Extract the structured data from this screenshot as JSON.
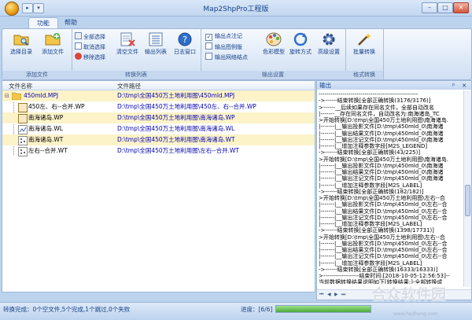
{
  "window": {
    "title": "Map2ShpPro工程版",
    "min": "–",
    "max": "□",
    "close": "✕",
    "qa_items": [
      "▸",
      "▾"
    ]
  },
  "tabs": [
    {
      "label": "功能"
    },
    {
      "label": "帮助"
    }
  ],
  "ribbon": {
    "add_group": {
      "label": "添加文件",
      "select_dir": "选择目录",
      "add_file": "添加文件"
    },
    "convert_group": {
      "label": "转换列表",
      "select_all": "全部选择",
      "deselect": "取消选择",
      "remove": "移除选择",
      "clear": "清空文件",
      "export_list": "输出列表",
      "log_window": "日志窗口"
    },
    "output_group": {
      "label": "输出设置",
      "opt1": "输出点注记",
      "opt2": "输出图例版",
      "opt3": "输出网络结点",
      "color_model": "色彩模型",
      "rotate": "旋转方式",
      "advanced": "高级设置"
    },
    "format_group": {
      "label": "格式转换",
      "batch": "批量转换"
    }
  },
  "file_panel": {
    "col_name": "文件名称",
    "col_path": "文件路径",
    "rows": [
      {
        "name": "450mld.MPJ",
        "path": "D:\\tmp\\全国450万土地利用图\\450mld.MPJ"
      },
      {
        "name": "450左、右--合并.WP",
        "path": "D:\\tmp\\全国450万土地利用图\\450左、右--合并.WP"
      },
      {
        "name": "南海诸岛.WP",
        "path": "D:\\tmp\\全国450万土地利用图\\南海诸岛.WP"
      },
      {
        "name": "南海诸岛.WL",
        "path": "D:\\tmp\\全国450万土地利用图\\南海诸岛.WL"
      },
      {
        "name": "南海诸岛.WT",
        "path": "D:\\tmp\\全国450万土地利用图\\南海诸岛.WT"
      },
      {
        "name": "左右--合并.WT",
        "path": "D:\\tmp\\全国450万土地利用图\\左右--合并.WT"
      }
    ]
  },
  "output_panel": {
    "title": "输出",
    "pin": "ᵖ",
    "close": "×",
    "lines": [
      "--------------------------------------------------",
      "->------结束转换[全部正确转换(3176/3176)]",
      ">------__后续如果存在同名文件，全部自动改名",
      "|-------__存在同名文件，自动改名为:南海诸岛_TC",
      ">开始转换[D:\\tmp\\全国450万土地利用图\\南海诸岛.",
      "|-------|__输出投影文件[D:\\tmp\\450mld_0\\南海诸",
      "|-------|__输出结果文件[D:\\tmp\\450mld_0\\南海诸",
      "|-------|__输出注记文件[D:\\tmp\\450mld_0\\南海诸",
      "|-------|__增加注释参数字段[M2S_LEGEND]",
      "->------结束转换[全部正确转换(43/225)]",
      ">开始转换[D:\\tmp\\全国450万土地利用图\\南海诸岛.",
      "|-------|__输出投影文件[D:\\tmp\\450mld_0\\南海诸",
      "|-------|__输出结果文件[D:\\tmp\\450mld_0\\南海诸",
      "|-------|__输出注记文件[D:\\tmp\\450mld_0\\南海诸",
      "|-------|__增加注释参数字段[M2S_LABEL]",
      "->------结束转换[全部正确转换(182/182)]",
      ">开始转换[D:\\tmp\\全国450万土地利用图\\左右--合",
      "|-------|__输出投影文件[D:\\tmp\\450mld_0\\左右--合",
      "|-------|__输出结果文件[D:\\tmp\\450mld_0\\左右--合",
      "|-------|__输出注记文件[D:\\tmp\\450mld_0\\左右--合",
      "|-------|__增加注释参数字段[M2S_LABEL]",
      "->------结束转换[全部正确转换(1398/17731)]",
      ">开始转换[D:\\tmp\\全国450万土地利用图\\左右--合",
      "|-------|__输出投影文件[D:\\tmp\\450mld_0\\左右--合",
      "|-------|__输出结果文件[D:\\tmp\\450mld_0\\左右--合",
      "|-------|__输出注记文件[D:\\tmp\\450mld_0\\左右--合",
      "|-------|__增加注释参数字段[M2S_LABEL]",
      "->------结束转换[全部正确转换(16333/16333)]",
      ">------------------结束时间:[2018-10-05-12:56:53]--",
      "当前数据转换结果说明如下[转换结果:]-全部转换成",
      "--------------------------------------------------",
      "|--------------------------------转换完成：0个空"
    ],
    "scroll_first": "⏮",
    "scroll_prev": "◀",
    "scroll_next": "▶",
    "scroll_last": "⏭"
  },
  "status": {
    "left": "转换完成：0个空文件,5个完成,1个跳过,0个失败",
    "progress_label": "进度：[6/6]",
    "progress": 1.0
  },
  "watermark": {
    "text": "合众软件园",
    "url": "www.hezhong.com"
  },
  "colors": {
    "accent": "#15428b",
    "ribbon_bg": "#dbe7f6",
    "frame": "#bcd3ee",
    "row_highlight": "#fdf3c9",
    "path_blue": "#0000b0"
  }
}
